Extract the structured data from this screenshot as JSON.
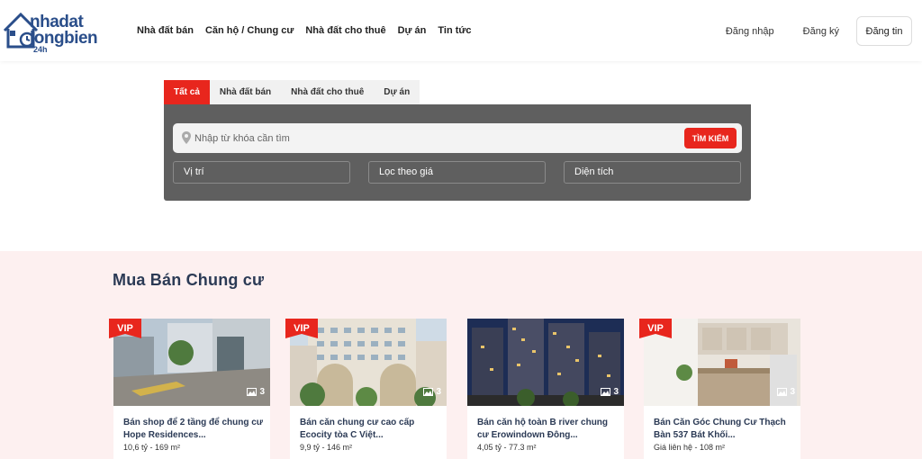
{
  "logo": {
    "line1": "nhadat",
    "line2": "longbien",
    "suffix": "24h"
  },
  "nav": [
    "Nhà đất bán",
    "Căn hộ / Chung cư",
    "Nhà đất cho thuê",
    "Dự án",
    "Tin tức"
  ],
  "auth": {
    "login": "Đăng nhập",
    "register": "Đăng ký",
    "post": "Đăng tin"
  },
  "search": {
    "tabs": [
      "Tất cả",
      "Nhà đất bán",
      "Nhà đất cho thuê",
      "Dự án"
    ],
    "active_tab": 0,
    "placeholder": "Nhập từ khóa cần tìm",
    "button": "TÌM KIẾM",
    "filters": {
      "location": "Vị trí",
      "price": "Lọc theo giá",
      "area": "Diện tích"
    }
  },
  "section": {
    "title": "Mua Bán Chung cư",
    "listings": [
      {
        "vip": "VIP",
        "photos": "3",
        "title": "Bán shop để 2 tầng để chung cư Hope Residences...",
        "meta": "10,6 tỷ - 169 m²"
      },
      {
        "vip": "VIP",
        "photos": "3",
        "title": "Bán căn chung cư cao cấp Ecocity tòa C Việt...",
        "meta": "9,9 tỷ - 146 m²"
      },
      {
        "vip": "",
        "photos": "3",
        "title": "Bán căn hộ toàn B river chung cư Erowindown Đông...",
        "meta": "4,05 tỷ - 77.3 m²"
      },
      {
        "vip": "VIP",
        "photos": "3",
        "title": "Bán Căn Góc Chung Cư Thạch Bàn 537 Bát Khối...",
        "meta": "Giá liên hệ - 108 m²"
      }
    ]
  },
  "colors": {
    "accent": "#e8261d",
    "brand": "#2a4e8a",
    "search_bg": "#5f5f5f",
    "section_bg": "#fdf0f0"
  }
}
